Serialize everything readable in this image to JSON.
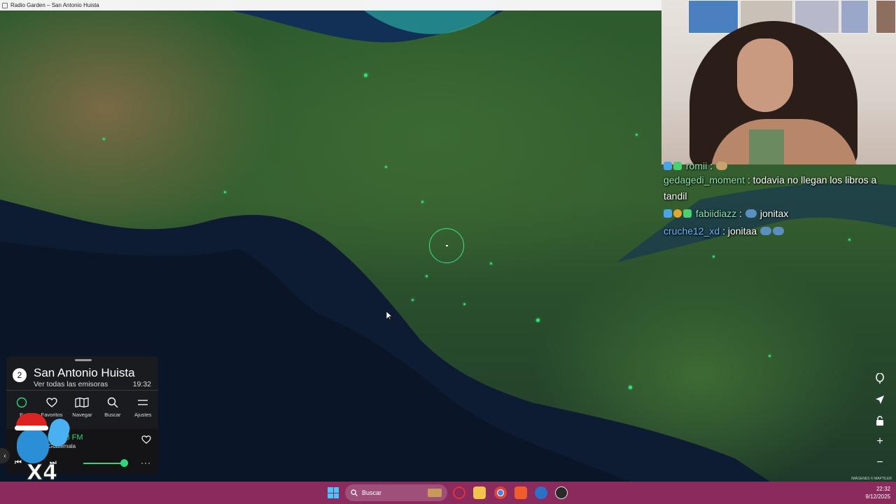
{
  "window": {
    "title": "Radio Garden – San Antonio Huista"
  },
  "panel": {
    "count": "2",
    "place_name": "San Antonio Huista",
    "all_stations_label": "Ver todas las emisoras",
    "local_time": "19:32",
    "nav": [
      {
        "label": "E",
        "icon": "explore-icon"
      },
      {
        "label": "Favoritos",
        "icon": "heart-icon"
      },
      {
        "label": "Navegar",
        "icon": "map-icon"
      },
      {
        "label": "Buscar",
        "icon": "search-icon"
      },
      {
        "label": "Ajustes",
        "icon": "menu-icon"
      }
    ],
    "now_playing": {
      "station": "a 91.3 FM",
      "location": "Guatemala",
      "volume": 0.9
    }
  },
  "chat": [
    {
      "user": "romii",
      "sep": ":",
      "text": "",
      "badges": [
        "sub",
        "green"
      ]
    },
    {
      "user": "gedagedi_moment",
      "sep": ":",
      "text": "todavia no llegan los libros a tandil",
      "badges": []
    },
    {
      "user": "fabiidiazz",
      "sep": ":",
      "text": "jonitax",
      "badges": [
        "sub",
        "gold",
        "green"
      ]
    },
    {
      "user": "cruche12_xd",
      "sep": ":",
      "text": "jonitaa",
      "badges": []
    }
  ],
  "mascot": {
    "multiplier": "X4"
  },
  "map": {
    "attribution": "IMÁGENES © MAPTILER"
  },
  "taskbar": {
    "search_placeholder": "Buscar",
    "time": "22:32",
    "date": "9/12/2025"
  },
  "colors": {
    "accent": "#2fd77a",
    "taskbar": "#8a2a5d",
    "panel": "#1c1c1e"
  }
}
